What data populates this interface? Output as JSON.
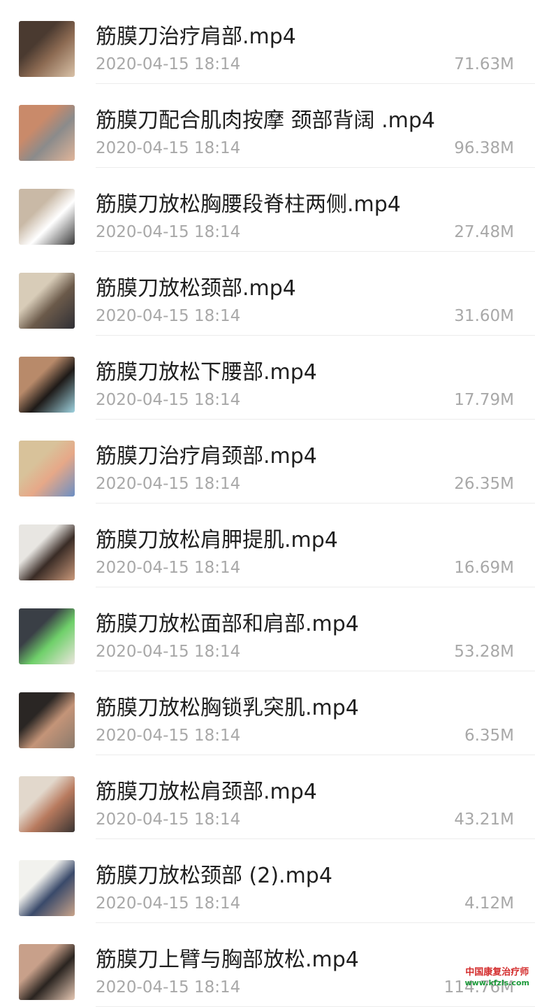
{
  "files": [
    {
      "name": "筋膜刀治疗肩部.mp4",
      "date": "2020-04-15 18:14",
      "size": "71.63M",
      "thumb_colors": [
        "#4a3a30",
        "#8c6a52",
        "#d9c2a8"
      ]
    },
    {
      "name": "筋膜刀配合肌肉按摩 颈部背阔 .mp4",
      "date": "2020-04-15 18:14",
      "size": "96.38M",
      "thumb_colors": [
        "#c98a6a",
        "#8b8b8b",
        "#e0b59a"
      ]
    },
    {
      "name": "筋膜刀放松胸腰段脊柱两侧.mp4",
      "date": "2020-04-15 18:14",
      "size": "27.48M",
      "thumb_colors": [
        "#c9b9a6",
        "#ffffff",
        "#3a3a3a"
      ]
    },
    {
      "name": "筋膜刀放松颈部.mp4",
      "date": "2020-04-15 18:14",
      "size": "31.60M",
      "thumb_colors": [
        "#d8ccb8",
        "#6b5a4a",
        "#2f2f35"
      ]
    },
    {
      "name": "筋膜刀放松下腰部.mp4",
      "date": "2020-04-15 18:14",
      "size": "17.79M",
      "thumb_colors": [
        "#b88a6a",
        "#1e1a18",
        "#9fd3e0"
      ]
    },
    {
      "name": "筋膜刀治疗肩颈部.mp4",
      "date": "2020-04-15 18:14",
      "size": "26.35M",
      "thumb_colors": [
        "#d8c29a",
        "#e6a888",
        "#6b8fc4"
      ]
    },
    {
      "name": "筋膜刀放松肩胛提肌.mp4",
      "date": "2020-04-15 18:14",
      "size": "16.69M",
      "thumb_colors": [
        "#e8e6e2",
        "#3a2c26",
        "#c9987a"
      ]
    },
    {
      "name": "筋膜刀放松面部和肩部.mp4",
      "date": "2020-04-15 18:14",
      "size": "53.28M",
      "thumb_colors": [
        "#3a3f46",
        "#6fd06a",
        "#ece6de"
      ]
    },
    {
      "name": "筋膜刀放松胸锁乳突肌.mp4",
      "date": "2020-04-15 18:14",
      "size": "6.35M",
      "thumb_colors": [
        "#2a2624",
        "#c49478",
        "#8a7a6c"
      ]
    },
    {
      "name": "筋膜刀放松肩颈部.mp4",
      "date": "2020-04-15 18:14",
      "size": "43.21M",
      "thumb_colors": [
        "#e2d8cc",
        "#b87a5e",
        "#3a3432"
      ]
    },
    {
      "name": "筋膜刀放松颈部 (2).mp4",
      "date": "2020-04-15 18:14",
      "size": "4.12M",
      "thumb_colors": [
        "#f2f2ee",
        "#3a4a6a",
        "#c9a48a"
      ]
    },
    {
      "name": "筋膜刀上臂与胸部放松.mp4",
      "date": "2020-04-15 18:14",
      "size": "114.76M",
      "thumb_colors": [
        "#c8a08a",
        "#2a2420",
        "#e6c8b4"
      ]
    }
  ],
  "watermark": {
    "line1": "中国康复治疗师",
    "line2": "www.kfzls.com"
  }
}
